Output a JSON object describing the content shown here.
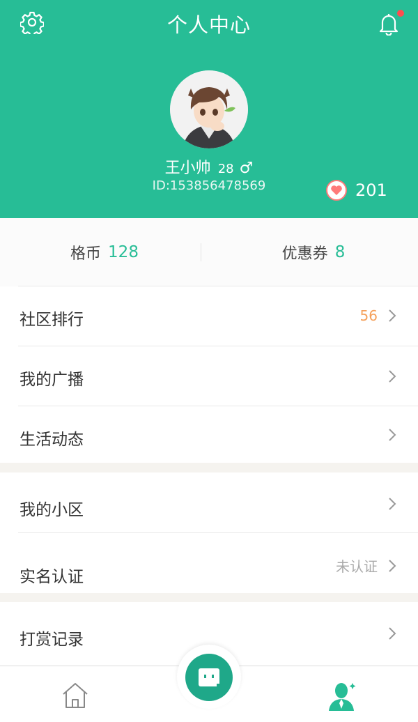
{
  "header": {
    "title": "个人中心",
    "bg_color": "#27bd96",
    "settings_icon": "gear-icon",
    "notification_icon": "bell-icon",
    "has_unread": true
  },
  "profile": {
    "name": "王小帅",
    "age": "28",
    "gender_symbol": "♂",
    "id_text": "ID:153856478569",
    "likes": "201"
  },
  "stats": {
    "coins_label": "格币",
    "coins_value": "128",
    "coupons_label": "优惠券",
    "coupons_value": "8"
  },
  "menu": {
    "items": [
      {
        "label": "社区排行",
        "value": "56",
        "value_color": "#f5a05a"
      },
      {
        "label": "我的广播",
        "value": ""
      },
      {
        "label": "生活动态",
        "value": ""
      },
      {
        "label": "我的小区",
        "value": ""
      },
      {
        "label": "实名认证",
        "value": "未认证",
        "value_color": "#aaaaaa"
      },
      {
        "label": "打赏记录",
        "value": ""
      }
    ]
  },
  "tabbar": {
    "tabs": [
      {
        "name": "home",
        "icon": "home-icon",
        "active": false
      },
      {
        "name": "center",
        "icon": "robot-icon",
        "active": false
      },
      {
        "name": "me",
        "icon": "user-icon",
        "active": true
      }
    ],
    "active_color": "#27bd96"
  }
}
